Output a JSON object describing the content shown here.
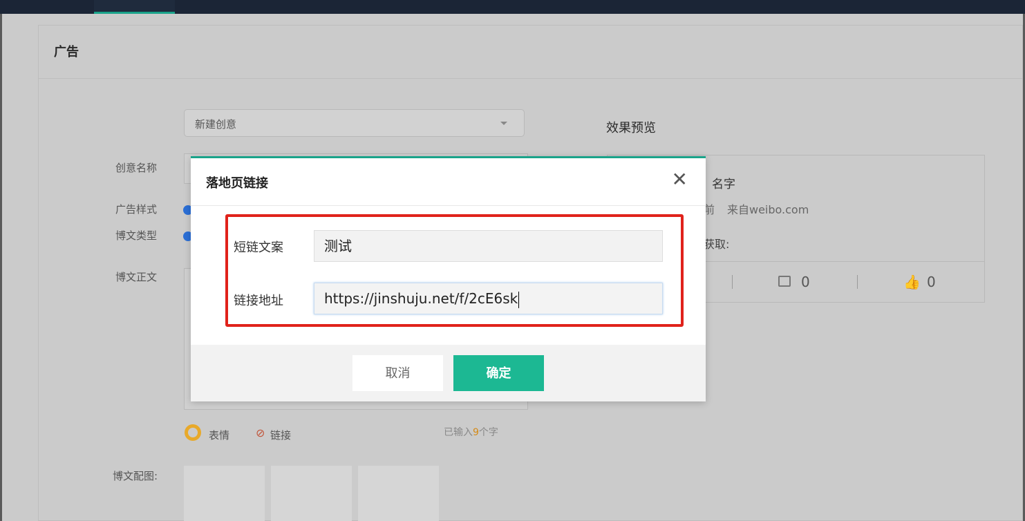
{
  "panel": {
    "title": "广告"
  },
  "creative_select": {
    "value": "新建创意"
  },
  "labels": {
    "creative_name": "创意名称",
    "ad_style": "广告样式",
    "post_type": "博文类型",
    "post_body": "博文正文",
    "post_images": "博文配图:"
  },
  "toolbar": {
    "emoji": "表情",
    "link": "链接",
    "count_prefix": "已输入",
    "count_num": "9",
    "count_suffix": "个字"
  },
  "preview": {
    "title": "效果预览",
    "name_partial": "名字",
    "time_partial": "前",
    "source": "来自weibo.com",
    "get_partial": "获取:",
    "comments": "0",
    "likes": "0"
  },
  "modal": {
    "title": "落地页链接",
    "close_icon": "close-icon",
    "short_link_label": "短链文案",
    "short_link_value": "测试",
    "url_label": "链接地址",
    "url_value": "https://jinshuju.net/f/2cE6sk",
    "cancel": "取消",
    "ok": "确定"
  },
  "colors": {
    "accent": "#1cb893",
    "highlight_box": "#e0221b",
    "topbar": "#1b2536"
  }
}
